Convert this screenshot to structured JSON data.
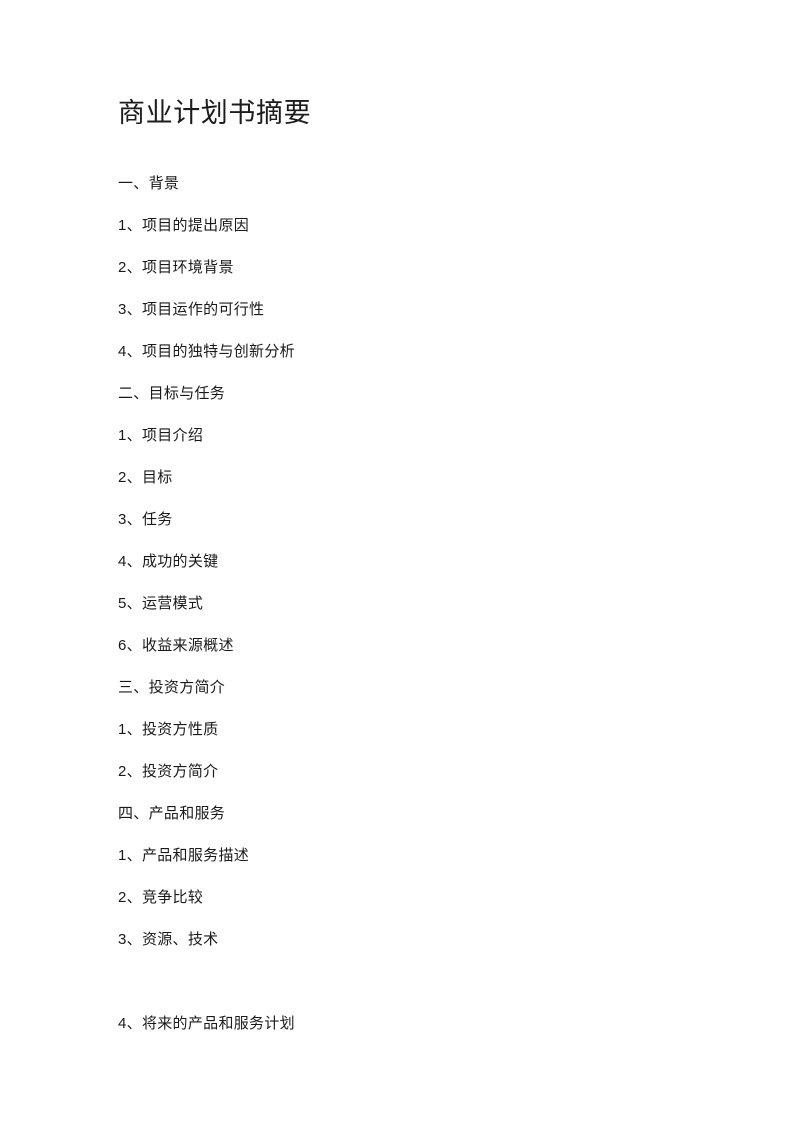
{
  "document": {
    "title": "商业计划书摘要",
    "page_background": "#ffffff",
    "text_color": "#1a1a1a",
    "outline": [
      {
        "text": "一、背景",
        "level": 1,
        "gap_before": false
      },
      {
        "text": "1、项目的提出原因",
        "level": 2,
        "gap_before": false
      },
      {
        "text": "2、项目环境背景",
        "level": 2,
        "gap_before": false
      },
      {
        "text": "3、项目运作的可行性",
        "level": 2,
        "gap_before": false
      },
      {
        "text": "4、项目的独特与创新分析",
        "level": 2,
        "gap_before": false
      },
      {
        "text": "二、目标与任务",
        "level": 1,
        "gap_before": false
      },
      {
        "text": "1、项目介绍",
        "level": 2,
        "gap_before": false
      },
      {
        "text": "2、目标",
        "level": 2,
        "gap_before": false
      },
      {
        "text": "3、任务",
        "level": 2,
        "gap_before": false
      },
      {
        "text": "4、成功的关键",
        "level": 2,
        "gap_before": false
      },
      {
        "text": "5、运营模式",
        "level": 2,
        "gap_before": false
      },
      {
        "text": "6、收益来源概述",
        "level": 2,
        "gap_before": false
      },
      {
        "text": "三、投资方简介",
        "level": 1,
        "gap_before": false
      },
      {
        "text": "1、投资方性质",
        "level": 2,
        "gap_before": false
      },
      {
        "text": "2、投资方简介",
        "level": 2,
        "gap_before": false
      },
      {
        "text": "四、产品和服务",
        "level": 1,
        "gap_before": false
      },
      {
        "text": "1、产品和服务描述",
        "level": 2,
        "gap_before": false
      },
      {
        "text": "2、竞争比较",
        "level": 2,
        "gap_before": false
      },
      {
        "text": "3、资源、技术",
        "level": 2,
        "gap_before": false
      },
      {
        "text": "4、将来的产品和服务计划",
        "level": 2,
        "gap_before": true
      }
    ]
  }
}
